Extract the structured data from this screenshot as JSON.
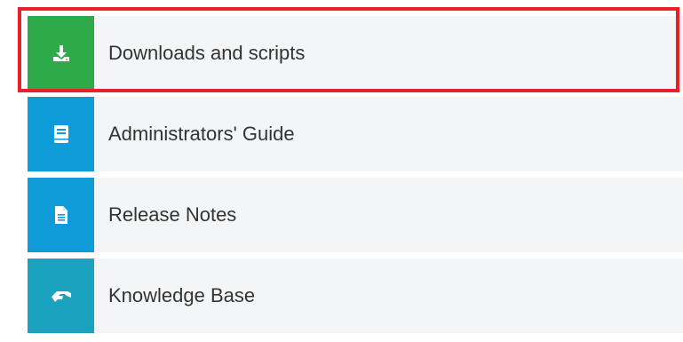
{
  "menu": {
    "items": [
      {
        "label": "Downloads and scripts",
        "icon": "download-icon",
        "color": "#2eaa4a",
        "highlighted": true
      },
      {
        "label": "Administrators' Guide",
        "icon": "book-icon",
        "color": "#0f9bd7",
        "highlighted": false
      },
      {
        "label": "Release Notes",
        "icon": "document-icon",
        "color": "#0f9bd7",
        "highlighted": false
      },
      {
        "label": "Knowledge Base",
        "icon": "handshake-icon",
        "color": "#1aa2bf",
        "highlighted": false
      }
    ]
  },
  "colors": {
    "highlight_border": "#e8202a",
    "row_background": "#f4f5f6",
    "label_text": "#333333"
  }
}
